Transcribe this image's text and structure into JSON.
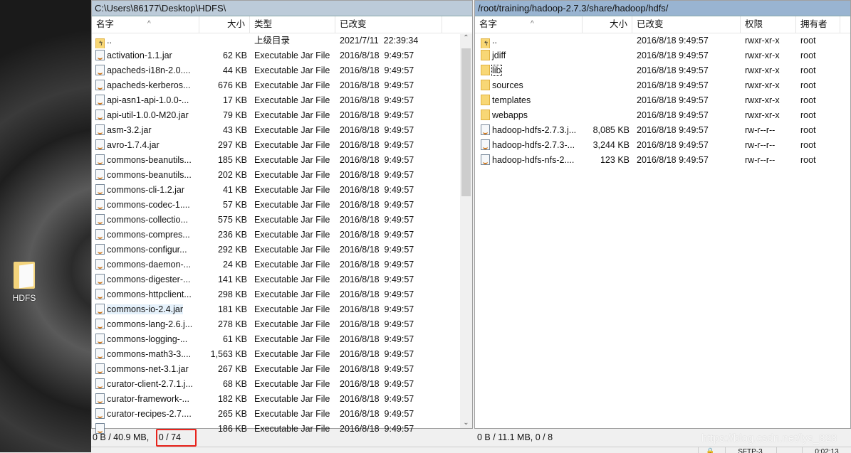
{
  "desktop": {
    "icon_label": "HDFS"
  },
  "left": {
    "path": "C:\\Users\\86177\\Desktop\\HDFS\\",
    "columns": [
      "名字",
      "大小",
      "类型",
      "已改变"
    ],
    "rows": [
      {
        "icon": "parent-dir-icon",
        "name": "..",
        "size": "",
        "type": "上级目录",
        "date": "2021/7/11  22:39:34"
      },
      {
        "icon": "jar-file-icon",
        "name": "activation-1.1.jar",
        "size": "62 KB",
        "type": "Executable Jar File",
        "date": "2016/8/18  9:49:57"
      },
      {
        "icon": "jar-file-icon",
        "name": "apacheds-i18n-2.0....",
        "size": "44 KB",
        "type": "Executable Jar File",
        "date": "2016/8/18  9:49:57"
      },
      {
        "icon": "jar-file-icon",
        "name": "apacheds-kerberos...",
        "size": "676 KB",
        "type": "Executable Jar File",
        "date": "2016/8/18  9:49:57"
      },
      {
        "icon": "jar-file-icon",
        "name": "api-asn1-api-1.0.0-...",
        "size": "17 KB",
        "type": "Executable Jar File",
        "date": "2016/8/18  9:49:57"
      },
      {
        "icon": "jar-file-icon",
        "name": "api-util-1.0.0-M20.jar",
        "size": "79 KB",
        "type": "Executable Jar File",
        "date": "2016/8/18  9:49:57"
      },
      {
        "icon": "jar-file-icon",
        "name": "asm-3.2.jar",
        "size": "43 KB",
        "type": "Executable Jar File",
        "date": "2016/8/18  9:49:57"
      },
      {
        "icon": "jar-file-icon",
        "name": "avro-1.7.4.jar",
        "size": "297 KB",
        "type": "Executable Jar File",
        "date": "2016/8/18  9:49:57"
      },
      {
        "icon": "jar-file-icon",
        "name": "commons-beanutils...",
        "size": "185 KB",
        "type": "Executable Jar File",
        "date": "2016/8/18  9:49:57"
      },
      {
        "icon": "jar-file-icon",
        "name": "commons-beanutils...",
        "size": "202 KB",
        "type": "Executable Jar File",
        "date": "2016/8/18  9:49:57"
      },
      {
        "icon": "jar-file-icon",
        "name": "commons-cli-1.2.jar",
        "size": "41 KB",
        "type": "Executable Jar File",
        "date": "2016/8/18  9:49:57"
      },
      {
        "icon": "jar-file-icon",
        "name": "commons-codec-1....",
        "size": "57 KB",
        "type": "Executable Jar File",
        "date": "2016/8/18  9:49:57"
      },
      {
        "icon": "jar-file-icon",
        "name": "commons-collectio...",
        "size": "575 KB",
        "type": "Executable Jar File",
        "date": "2016/8/18  9:49:57"
      },
      {
        "icon": "jar-file-icon",
        "name": "commons-compres...",
        "size": "236 KB",
        "type": "Executable Jar File",
        "date": "2016/8/18  9:49:57"
      },
      {
        "icon": "jar-file-icon",
        "name": "commons-configur...",
        "size": "292 KB",
        "type": "Executable Jar File",
        "date": "2016/8/18  9:49:57"
      },
      {
        "icon": "jar-file-icon",
        "name": "commons-daemon-...",
        "size": "24 KB",
        "type": "Executable Jar File",
        "date": "2016/8/18  9:49:57"
      },
      {
        "icon": "jar-file-icon",
        "name": "commons-digester-...",
        "size": "141 KB",
        "type": "Executable Jar File",
        "date": "2016/8/18  9:49:57"
      },
      {
        "icon": "jar-file-icon",
        "name": "commons-httpclient...",
        "size": "298 KB",
        "type": "Executable Jar File",
        "date": "2016/8/18  9:49:57"
      },
      {
        "icon": "jar-file-icon",
        "name": "commons-io-2.4.jar",
        "size": "181 KB",
        "type": "Executable Jar File",
        "date": "2016/8/18  9:49:57",
        "hover": true
      },
      {
        "icon": "jar-file-icon",
        "name": "commons-lang-2.6.j...",
        "size": "278 KB",
        "type": "Executable Jar File",
        "date": "2016/8/18  9:49:57"
      },
      {
        "icon": "jar-file-icon",
        "name": "commons-logging-...",
        "size": "61 KB",
        "type": "Executable Jar File",
        "date": "2016/8/18  9:49:57"
      },
      {
        "icon": "jar-file-icon",
        "name": "commons-math3-3....",
        "size": "1,563 KB",
        "type": "Executable Jar File",
        "date": "2016/8/18  9:49:57"
      },
      {
        "icon": "jar-file-icon",
        "name": "commons-net-3.1.jar",
        "size": "267 KB",
        "type": "Executable Jar File",
        "date": "2016/8/18  9:49:57"
      },
      {
        "icon": "jar-file-icon",
        "name": "curator-client-2.7.1.j...",
        "size": "68 KB",
        "type": "Executable Jar File",
        "date": "2016/8/18  9:49:57"
      },
      {
        "icon": "jar-file-icon",
        "name": "curator-framework-...",
        "size": "182 KB",
        "type": "Executable Jar File",
        "date": "2016/8/18  9:49:57"
      },
      {
        "icon": "jar-file-icon",
        "name": "curator-recipes-2.7....",
        "size": "265 KB",
        "type": "Executable Jar File",
        "date": "2016/8/18  9:49:57"
      },
      {
        "icon": "jar-file-icon",
        "name": "",
        "size": "186 KB",
        "type": "Executable Jar File",
        "date": "2016/8/18  9:49:57"
      }
    ],
    "status": "0 B / 40.9 MB,",
    "status_count": "0 / 74"
  },
  "right": {
    "path": "/root/training/hadoop-2.7.3/share/hadoop/hdfs/",
    "columns": [
      "名字",
      "大小",
      "已改变",
      "权限",
      "拥有者"
    ],
    "rows": [
      {
        "icon": "parent-dir-icon",
        "name": "..",
        "size": "",
        "date": "2016/8/18 9:49:57",
        "perm": "rwxr-xr-x",
        "owner": "root"
      },
      {
        "icon": "folder-icon",
        "name": "jdiff",
        "size": "",
        "date": "2016/8/18 9:49:57",
        "perm": "rwxr-xr-x",
        "owner": "root"
      },
      {
        "icon": "folder-icon",
        "name": "lib",
        "size": "",
        "date": "2016/8/18 9:49:57",
        "perm": "rwxr-xr-x",
        "owner": "root",
        "focused": true
      },
      {
        "icon": "folder-icon",
        "name": "sources",
        "size": "",
        "date": "2016/8/18 9:49:57",
        "perm": "rwxr-xr-x",
        "owner": "root"
      },
      {
        "icon": "folder-icon",
        "name": "templates",
        "size": "",
        "date": "2016/8/18 9:49:57",
        "perm": "rwxr-xr-x",
        "owner": "root"
      },
      {
        "icon": "folder-icon",
        "name": "webapps",
        "size": "",
        "date": "2016/8/18 9:49:57",
        "perm": "rwxr-xr-x",
        "owner": "root"
      },
      {
        "icon": "jar-file-icon",
        "name": "hadoop-hdfs-2.7.3.j...",
        "size": "8,085 KB",
        "date": "2016/8/18 9:49:57",
        "perm": "rw-r--r--",
        "owner": "root"
      },
      {
        "icon": "jar-file-icon",
        "name": "hadoop-hdfs-2.7.3-...",
        "size": "3,244 KB",
        "date": "2016/8/18 9:49:57",
        "perm": "rw-r--r--",
        "owner": "root"
      },
      {
        "icon": "jar-file-icon",
        "name": "hadoop-hdfs-nfs-2....",
        "size": "123 KB",
        "date": "2016/8/18 9:49:57",
        "perm": "rw-r--r--",
        "owner": "root"
      }
    ],
    "status": "0 B / 11.1 MB,  0 / 8"
  },
  "bottom": {
    "protocol": "SFTP-3",
    "time": "0:02:13"
  },
  "watermark": "https://blog.csdn.net/lys_828",
  "colors": {
    "highlight_box": "#e8231c",
    "path_bar_remote": "#99b4d1"
  }
}
